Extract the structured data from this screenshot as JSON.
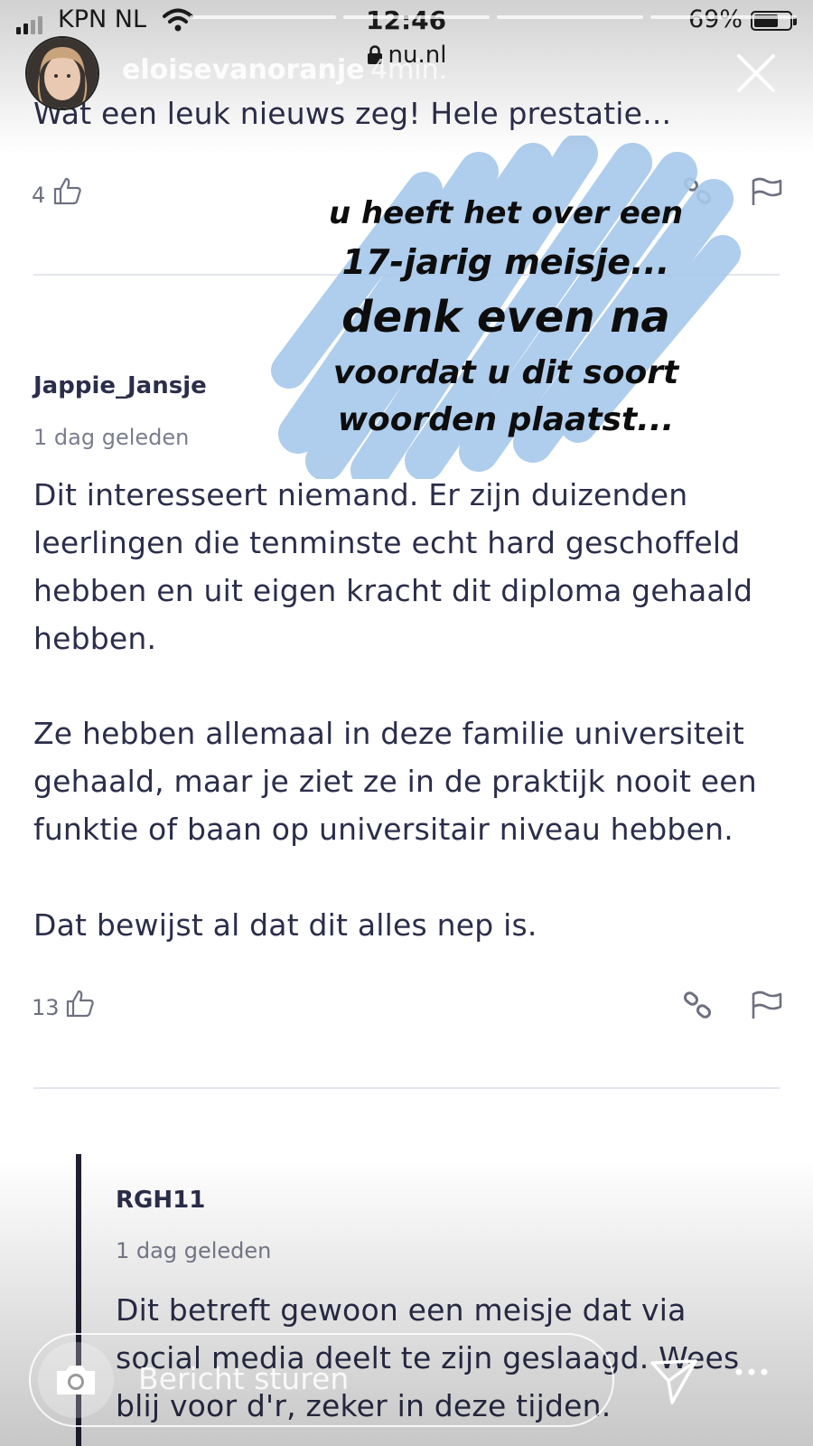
{
  "status_bar": {
    "carrier": "KPN NL",
    "time": "12:46",
    "battery": "69%",
    "battery_level": 0.69
  },
  "browser": {
    "url": "nu.nl"
  },
  "story": {
    "username": "eloisevanoranje",
    "time_ago": "4min."
  },
  "comments": [
    {
      "text_partial": "Wat een leuk nieuws zeg! Hele prestatie...",
      "likes": "4"
    },
    {
      "author": "Jappie_Jansje",
      "time": "1 dag geleden",
      "lines": [
        "Dit interesseert niemand. Er zijn duizenden",
        "leerlingen die tenminste echt hard geschoffeld",
        "hebben en uit eigen kracht dit diploma gehaald",
        "hebben.",
        "Ze hebben allemaal in deze familie universiteit",
        "gehaald, maar je ziet ze in de praktijk nooit een",
        "funktie of baan op universitair niveau hebben.",
        "Dat bewijst al dat dit alles nep is."
      ],
      "likes": "13"
    }
  ],
  "reply": {
    "author": "RGH11",
    "time": "1 dag geleden",
    "lines": [
      "Dit betreft gewoon een meisje dat via",
      "social media deelt te zijn geslaagd. Wees",
      "blij voor d'r, zeker in deze tijden."
    ]
  },
  "sticker": {
    "color": "#a7c8ea",
    "lines": [
      "u heeft het over een",
      "17-jarig meisje...",
      "denk even na",
      "voordat u dit soort",
      "woorden plaatst..."
    ]
  },
  "composer": {
    "placeholder": "Bericht sturen"
  }
}
